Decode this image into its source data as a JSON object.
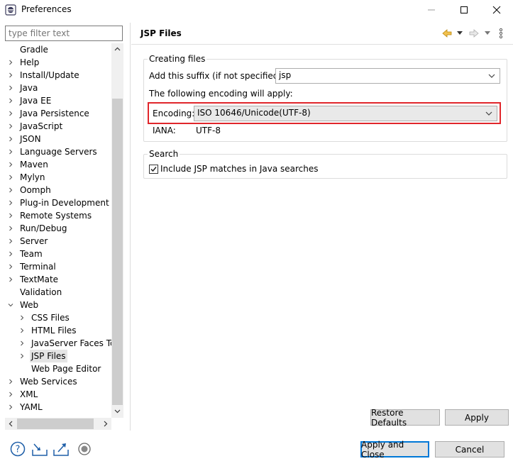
{
  "window": {
    "title": "Preferences",
    "app_icon": "eclipse-icon",
    "controls": [
      "minimize-icon",
      "maximize-icon",
      "close-icon"
    ]
  },
  "filter": {
    "placeholder": "type filter text",
    "value": ""
  },
  "tree": {
    "items": [
      {
        "label": "Gradle",
        "level": 0,
        "expandable": false
      },
      {
        "label": "Help",
        "level": 0,
        "expandable": true
      },
      {
        "label": "Install/Update",
        "level": 0,
        "expandable": true
      },
      {
        "label": "Java",
        "level": 0,
        "expandable": true
      },
      {
        "label": "Java EE",
        "level": 0,
        "expandable": true
      },
      {
        "label": "Java Persistence",
        "level": 0,
        "expandable": true
      },
      {
        "label": "JavaScript",
        "level": 0,
        "expandable": true
      },
      {
        "label": "JSON",
        "level": 0,
        "expandable": true
      },
      {
        "label": "Language Servers",
        "level": 0,
        "expandable": true
      },
      {
        "label": "Maven",
        "level": 0,
        "expandable": true
      },
      {
        "label": "Mylyn",
        "level": 0,
        "expandable": true
      },
      {
        "label": "Oomph",
        "level": 0,
        "expandable": true
      },
      {
        "label": "Plug-in Development",
        "level": 0,
        "expandable": true
      },
      {
        "label": "Remote Systems",
        "level": 0,
        "expandable": true
      },
      {
        "label": "Run/Debug",
        "level": 0,
        "expandable": true
      },
      {
        "label": "Server",
        "level": 0,
        "expandable": true
      },
      {
        "label": "Team",
        "level": 0,
        "expandable": true
      },
      {
        "label": "Terminal",
        "level": 0,
        "expandable": true
      },
      {
        "label": "TextMate",
        "level": 0,
        "expandable": true
      },
      {
        "label": "Validation",
        "level": 0,
        "expandable": false
      },
      {
        "label": "Web",
        "level": 0,
        "expandable": true,
        "expanded": true
      },
      {
        "label": "CSS Files",
        "level": 1,
        "expandable": true
      },
      {
        "label": "HTML Files",
        "level": 1,
        "expandable": true
      },
      {
        "label": "JavaServer Faces Tools",
        "level": 1,
        "expandable": true
      },
      {
        "label": "JSP Files",
        "level": 1,
        "expandable": true,
        "selected": true
      },
      {
        "label": "Web Page Editor",
        "level": 1,
        "expandable": false
      },
      {
        "label": "Web Services",
        "level": 0,
        "expandable": true
      },
      {
        "label": "XML",
        "level": 0,
        "expandable": true
      },
      {
        "label": "YAML",
        "level": 0,
        "expandable": true
      }
    ]
  },
  "page": {
    "title": "JSP Files",
    "nav_icons": [
      "back-arrow-icon",
      "back-dropdown-icon",
      "forward-arrow-icon",
      "forward-dropdown-icon",
      "view-menu-icon"
    ],
    "creating_files": {
      "title": "Creating files",
      "suffix_label": "Add this suffix (if not specified):",
      "suffix_value": "jsp",
      "encoding_note": "The following encoding will apply:",
      "encoding_label": "Encoding:",
      "encoding_value": "ISO 10646/Unicode(UTF-8)",
      "iana_label": "IANA:",
      "iana_value": "UTF-8"
    },
    "search": {
      "title": "Search",
      "include_label": "Include JSP matches in Java searches",
      "include_checked": true
    },
    "restore_defaults": "Restore Defaults",
    "apply": "Apply"
  },
  "footer": {
    "icons": [
      "help-icon",
      "import-icon",
      "export-icon",
      "record-icon"
    ],
    "apply_close": "Apply and Close",
    "cancel": "Cancel"
  },
  "colors": {
    "highlight": "#e0262b",
    "default_button_border": "#0078d7",
    "link_blue": "#1f5fa8"
  }
}
